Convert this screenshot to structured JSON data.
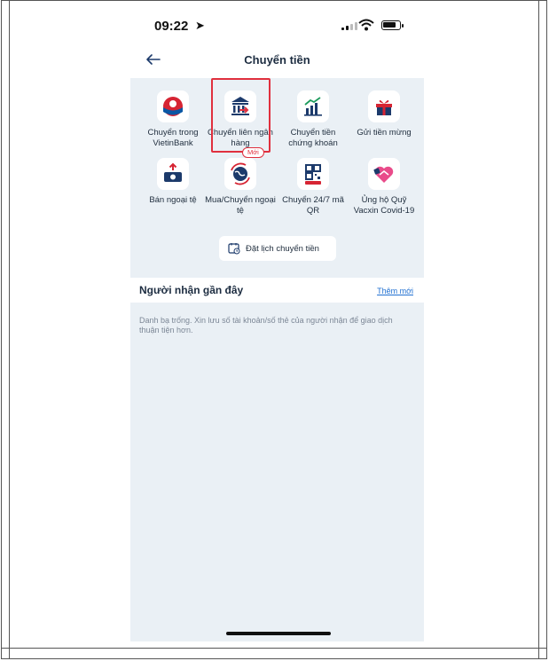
{
  "status_bar": {
    "time": "09:22",
    "location_arrow": "location-arrow-icon"
  },
  "header": {
    "title": "Chuyển tiền",
    "back_icon": "back-arrow-icon"
  },
  "services": [
    {
      "label": "Chuyển trong VietinBank",
      "icon": "vietinbank-logo-icon"
    },
    {
      "label": "Chuyển liên ngân hàng",
      "icon": "bank-transfer-icon"
    },
    {
      "label": "Chuyển tiền chứng khoán",
      "icon": "stock-chart-icon"
    },
    {
      "label": "Gửi tiền mừng",
      "icon": "gift-icon"
    },
    {
      "label": "Bán ngoại tệ",
      "icon": "sell-currency-icon"
    },
    {
      "label": "Mua/Chuyển ngoại tệ",
      "icon": "globe-exchange-icon"
    },
    {
      "label": "Chuyển 24/7 mã QR",
      "icon": "qr-code-icon"
    },
    {
      "label": "Ủng hộ Quỹ Vacxin Covid-19",
      "icon": "heart-donate-icon"
    }
  ],
  "badge_new": "Mới",
  "schedule_button": "Đặt lịch chuyển tiền",
  "recent": {
    "title": "Người nhận gần đây",
    "add_new": "Thêm mới",
    "empty_message": "Danh bạ trống. Xin lưu số tài khoản/số thẻ của người nhận để giao dịch thuận tiện hơn."
  },
  "colors": {
    "accent_red": "#e0303e",
    "link_blue": "#1f6fd1",
    "background": "#eaf0f5",
    "navy": "#1c3a6b"
  }
}
